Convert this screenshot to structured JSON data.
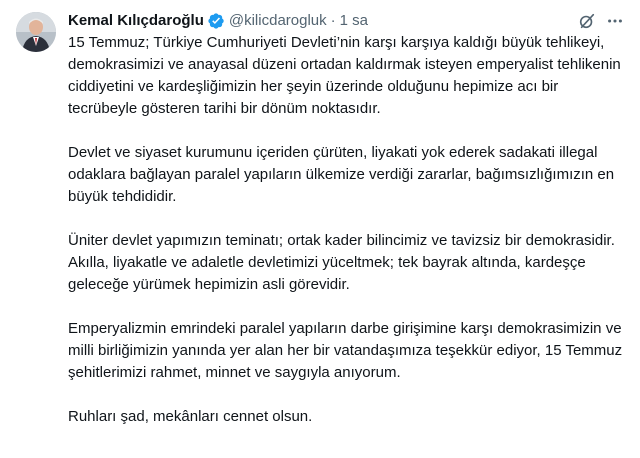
{
  "tweet": {
    "author_name": "Kemal Kılıçdaroğlu",
    "handle": "@kilicdarogluk",
    "separator": "·",
    "time": "1 sa",
    "verified_icon": "verified-badge-icon",
    "grok_icon": "grok-icon",
    "more_icon": "more-options-icon",
    "accent_color": "#1d9bf0",
    "paragraphs": [
      "15 Temmuz; Türkiye Cumhuriyeti Devleti’nin karşı karşıya kaldığı büyük tehlikeyi, demokrasimizi ve anayasal düzeni ortadan kaldırmak isteyen emperyalist tehlikenin ciddiyetini ve kardeşliğimizin her şeyin üzerinde olduğunu hepimize acı bir tecrübeyle gösteren tarihi bir dönüm noktasıdır.",
      "Devlet ve siyaset kurumunu içeriden çürüten, liyakati yok ederek sadakati illegal odaklara bağlayan paralel yapıların ülkemize verdiği zararlar, bağımsızlığımızın en büyük tehdididir.",
      "Üniter devlet yapımızın teminatı; ortak kader bilincimiz ve tavizsiz bir demokrasidir. Akılla, liyakatle ve adaletle devletimizi yüceltmek; tek bayrak altında, kardeşçe geleceğe yürümek hepimizin asli görevidir.",
      "Emperyalizmin emrindeki paralel yapıların darbe girişimine karşı demokrasimizin ve milli birliğimizin yanında yer alan her bir vatandaşımıza teşekkür ediyor, 15 Temmuz şehitlerimizi rahmet, minnet ve saygıyla anıyorum.",
      "Ruhları şad, mekânları cennet olsun."
    ]
  }
}
